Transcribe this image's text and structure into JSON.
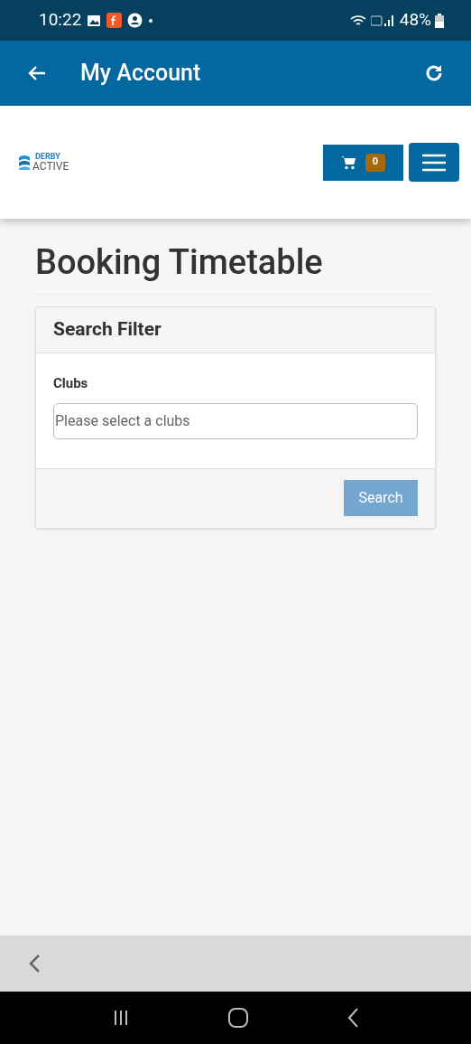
{
  "status_bar": {
    "time": "10:22",
    "battery": "48%"
  },
  "app_bar": {
    "title": "My Account"
  },
  "header": {
    "logo": {
      "small": "DERBY",
      "large": "ACTIVE"
    },
    "cart_count": "0"
  },
  "page": {
    "title": "Booking Timetable"
  },
  "filter": {
    "title": "Search Filter",
    "field_label": "Clubs",
    "placeholder": "Please select a clubs",
    "button": {
      "label": "Search",
      "disabled": true
    }
  }
}
